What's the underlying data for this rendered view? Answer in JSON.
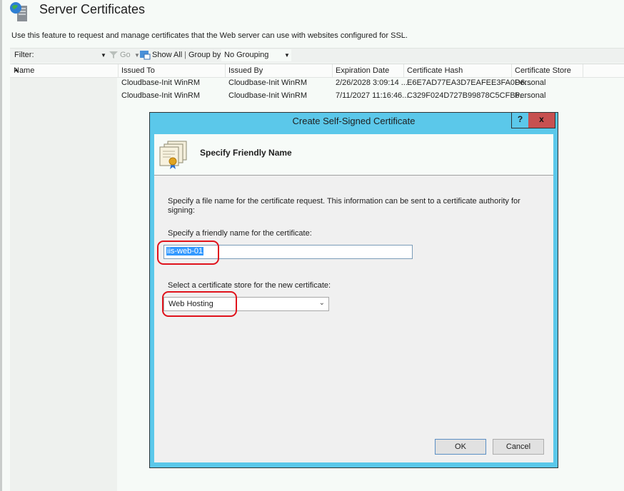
{
  "page": {
    "title": "Server Certificates",
    "description": "Use this feature to request and manage certificates that the Web server can use with websites configured for SSL."
  },
  "toolbar": {
    "filter_label": "Filter:",
    "go_label": "Go",
    "show_all_label": "Show All",
    "separator": "|",
    "group_by_label": "Group by:",
    "group_by_value": "No Grouping"
  },
  "grid": {
    "columns": [
      "Name",
      "Issued To",
      "Issued By",
      "Expiration Date",
      "Certificate Hash",
      "Certificate Store"
    ],
    "sort_column": "Name",
    "rows": [
      {
        "name": "",
        "issued_to": "Cloudbase-Init WinRM",
        "issued_by": "Cloudbase-Init WinRM",
        "expiration": "2/26/2028 3:09:14 ...",
        "hash": "E6E7AD77EA3D7EAFEE3FA0D6...",
        "store": "Personal"
      },
      {
        "name": "",
        "issued_to": "Cloudbase-Init WinRM",
        "issued_by": "Cloudbase-Init WinRM",
        "expiration": "7/11/2027 11:16:46...",
        "hash": "C329F024D727B99878C5CFB6...",
        "store": "Personal"
      }
    ]
  },
  "dialog": {
    "title": "Create Self-Signed Certificate",
    "help_label": "?",
    "close_label": "x",
    "banner_title": "Specify Friendly Name",
    "instructions_line1": "Specify a file name for the certificate request.  This information can be sent to a certificate authority for",
    "instructions_line2": "signing:",
    "friendly_name_label": "Specify a friendly name for the certificate:",
    "friendly_name_value": "iis-web-01",
    "store_label": "Select a certificate store for the new certificate:",
    "store_value": "Web Hosting",
    "ok_label": "OK",
    "cancel_label": "Cancel",
    "colors": {
      "titlebar": "#5bc8ea",
      "close": "#c75050",
      "highlight": "#e0131c"
    }
  }
}
